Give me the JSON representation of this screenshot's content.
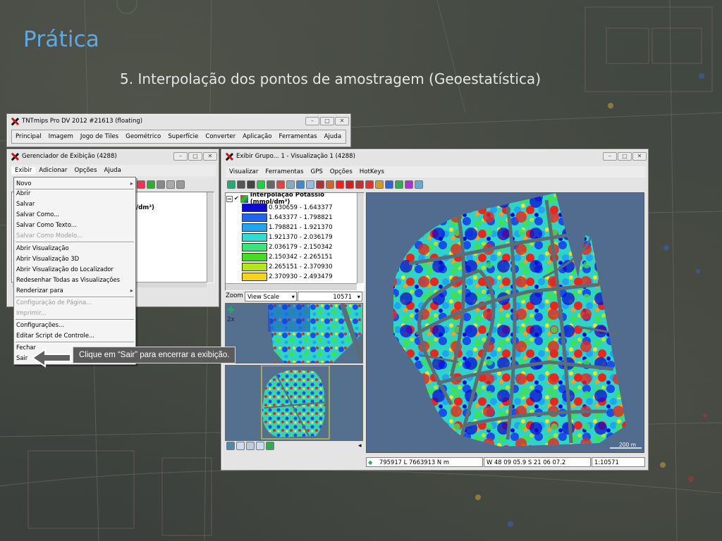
{
  "slide": {
    "title": "Prática",
    "subtitle": "5. Interpolação dos pontos de amostragem (Geoestatística)"
  },
  "main_window": {
    "title": "TNTmips Pro DV 2012  #21613 (floating)",
    "menu": [
      "Principal",
      "Imagem",
      "Jogo de Tiles",
      "Geométrico",
      "Superfície",
      "Converter",
      "Aplicação",
      "Ferramentas",
      "Ajuda"
    ]
  },
  "display_manager": {
    "title": "Gerenciador de Exibição (4288)",
    "menu": [
      "Exibir",
      "Adicionar",
      "Opções",
      "Ajuda"
    ],
    "partial_unit_text": "/dm³)"
  },
  "file_menu": {
    "items": [
      {
        "label": "Novo",
        "disabled": false
      },
      {
        "label": "Abrir",
        "disabled": false
      },
      {
        "label": "Salvar",
        "disabled": false
      },
      {
        "label": "Salvar Como...",
        "disabled": false
      },
      {
        "label": "Salvar Como Texto...",
        "disabled": false
      },
      {
        "label": "Salvar Como Modelo...",
        "disabled": true
      },
      {
        "label": "Abrir Visualização",
        "disabled": false
      },
      {
        "label": "Abrir Visualização 3D",
        "disabled": false
      },
      {
        "label": "Abrir Visualização do Localizador",
        "disabled": false
      },
      {
        "label": "Redesenhar Todas as Visualizações",
        "disabled": false
      },
      {
        "label": "Renderizar para",
        "disabled": false
      },
      {
        "label": "Configuração de Página...",
        "disabled": true
      },
      {
        "label": "Imprimir...",
        "disabled": true
      },
      {
        "label": "Configurações...",
        "disabled": false
      },
      {
        "label": "Editar Script de Controle...",
        "disabled": false
      },
      {
        "label": "Fechar",
        "disabled": false
      },
      {
        "label": "Sair",
        "disabled": false
      }
    ]
  },
  "callout": {
    "text": "Clique em “Sair” para encerrar a exibição."
  },
  "view_window": {
    "title": "Exibir Grupo... 1 - Visualização 1 (4288)",
    "menu": [
      "Visualizar",
      "Ferramentas",
      "GPS",
      "Opções",
      "HotKeys"
    ],
    "zoom_label": "Zoom",
    "zoom_mode": "View Scale",
    "zoom_value": "10571",
    "zoom_factor": "2x",
    "scale_bar": "200 m",
    "status_coords": "795917 L  7663913 N m",
    "status_latlon": "W 48 09 05.9  S 21 06 07.2",
    "status_scale": "1:10571"
  },
  "legend": {
    "title": "Interpolação Potássio (mmol/dm³)",
    "classes": [
      {
        "range": "0.930659 - 1.643377",
        "color": "#0b0bd6"
      },
      {
        "range": "1.643377 - 1.798821",
        "color": "#1e66f0"
      },
      {
        "range": "1.798821 - 1.921370",
        "color": "#1ea6f4"
      },
      {
        "range": "1.921370 - 2.036179",
        "color": "#33dcd2"
      },
      {
        "range": "2.036179 - 2.150342",
        "color": "#3be47a"
      },
      {
        "range": "2.150342 - 2.265151",
        "color": "#45dc22"
      },
      {
        "range": "2.265151 - 2.370930",
        "color": "#b4e61e"
      },
      {
        "range": "2.370930 - 2.493479",
        "color": "#f5d21e"
      }
    ]
  },
  "colors": {
    "title_blue": "#5ea9e4",
    "map_background": "#516c8e",
    "road_gray": "#5a6e7a",
    "high_red": "#e8261c"
  }
}
